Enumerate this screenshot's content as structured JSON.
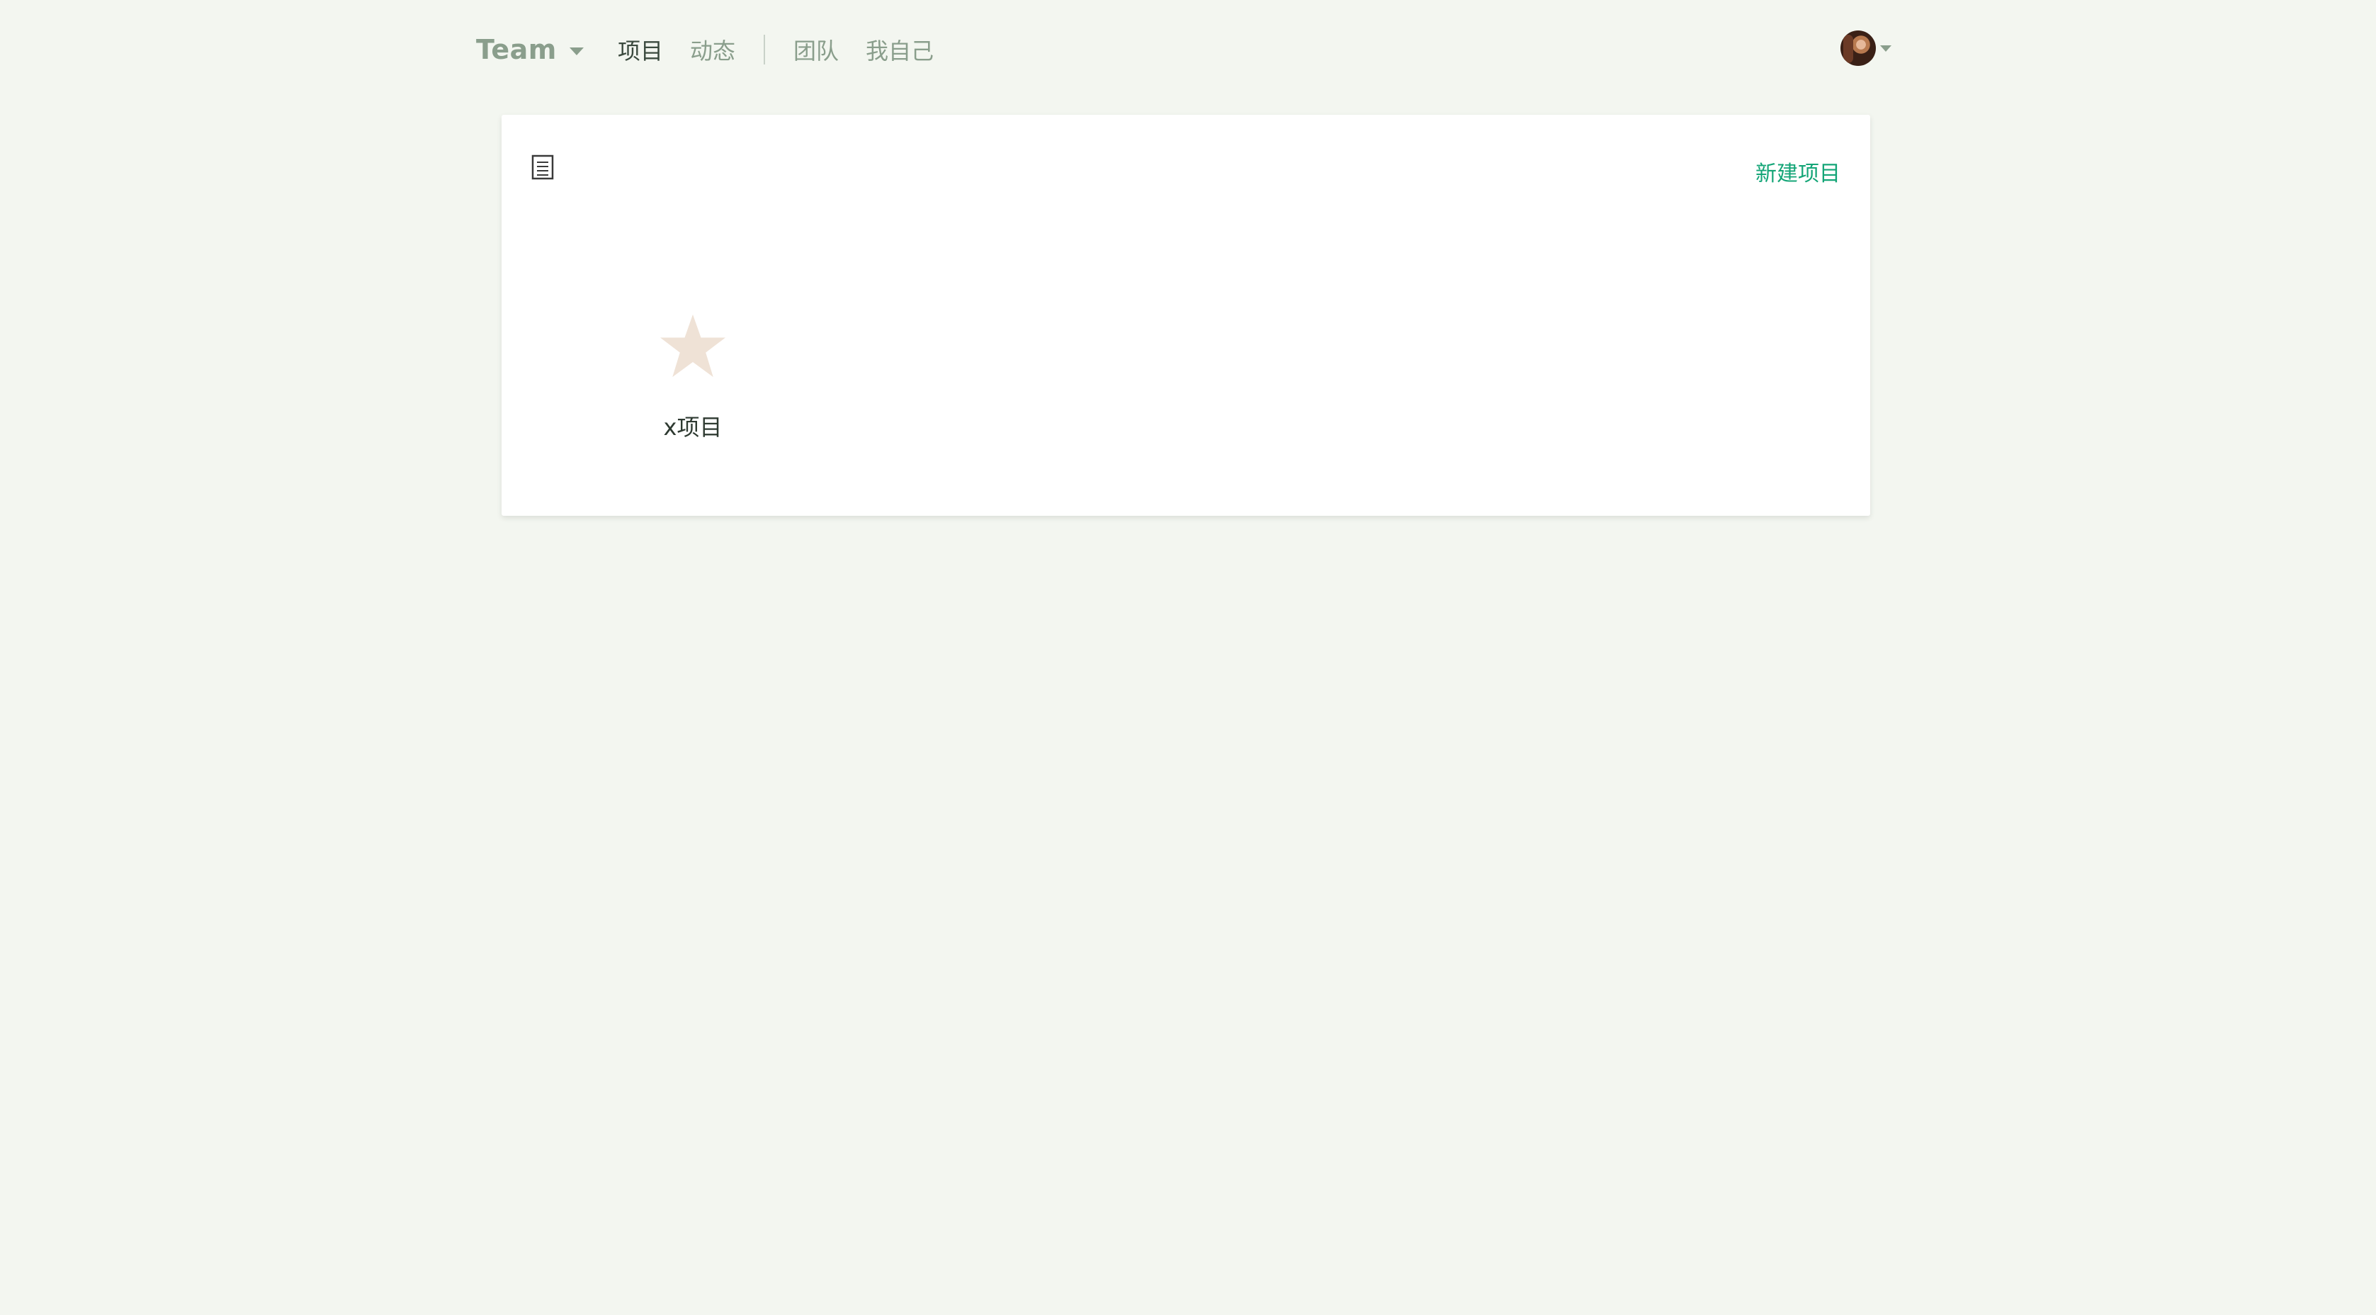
{
  "header": {
    "team_label": "Team",
    "nav": [
      {
        "label": "项目",
        "active": true
      },
      {
        "label": "动态",
        "active": false
      },
      {
        "label": "团队",
        "active": false
      },
      {
        "label": "我自己",
        "active": false
      }
    ]
  },
  "main": {
    "view_icon": "list-view-icon",
    "new_project_label": "新建项目",
    "projects": [
      {
        "name": "x项目",
        "icon": "star-icon"
      }
    ]
  },
  "colors": {
    "background": "#f3f6f0",
    "nav_text": "#8a9e8c",
    "nav_active": "#3b4a3e",
    "accent": "#14a577",
    "star": "#efe2d6"
  }
}
